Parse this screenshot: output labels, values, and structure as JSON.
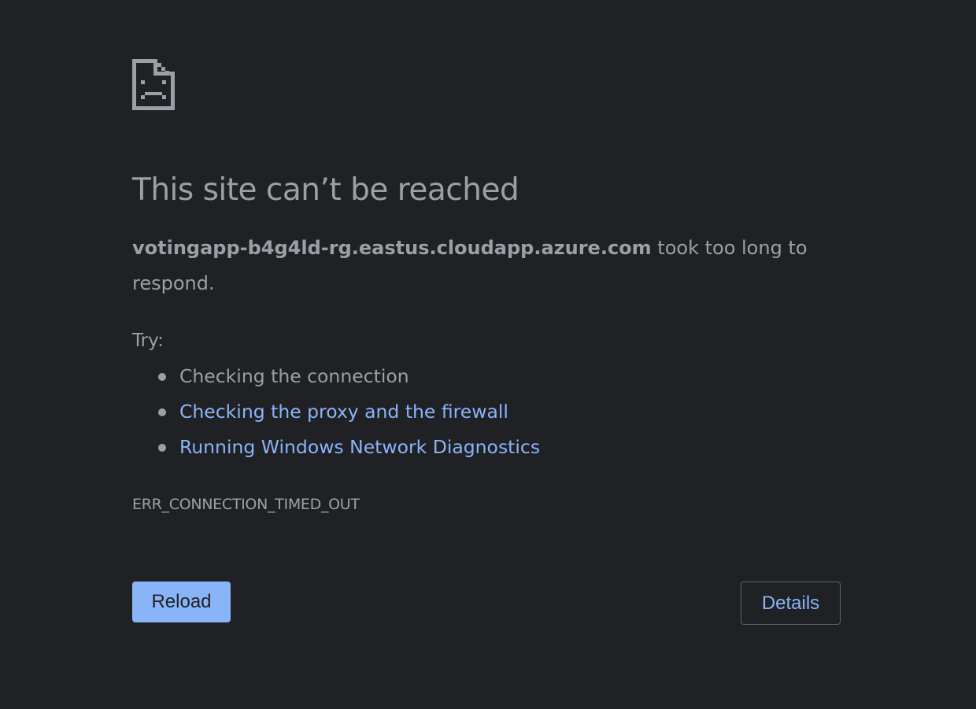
{
  "error_page": {
    "icon": "sad-document-icon",
    "title": "This site can’t be reached",
    "host": "votingapp-b4g4ld-rg.eastus.cloudapp.azure.com",
    "summary_suffix": " took too long to respond.",
    "try_label": "Try:",
    "suggestions": [
      {
        "text": "Checking the connection",
        "link": false
      },
      {
        "text": "Checking the proxy and the firewall",
        "link": true
      },
      {
        "text": "Running Windows Network Diagnostics",
        "link": true
      }
    ],
    "error_code": "ERR_CONNECTION_TIMED_OUT",
    "reload_label": "Reload",
    "details_label": "Details"
  },
  "colors": {
    "background": "#202124",
    "text": "#9aa0a6",
    "link": "#8ab4f8",
    "button_primary_bg": "#8ab4f8",
    "button_border": "#5f6368"
  }
}
